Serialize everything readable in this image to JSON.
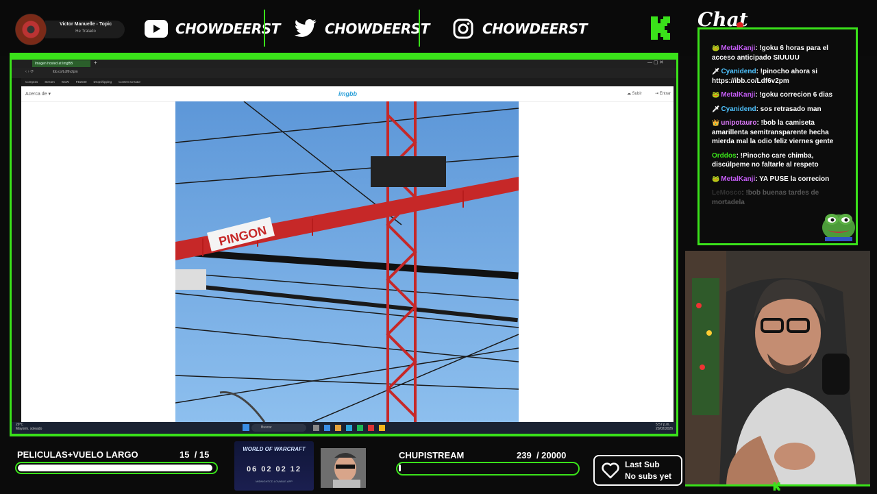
{
  "music": {
    "title": "Victor Manuelle - Topic",
    "subtitle": "He Tratado"
  },
  "socials": [
    {
      "icon": "youtube-icon",
      "name": "CHOWDEERST"
    },
    {
      "icon": "twitter-icon",
      "name": "CHOWDEERST"
    },
    {
      "icon": "instagram-icon",
      "name": "CHOWDEERST"
    }
  ],
  "chat": {
    "title": "Chat",
    "messages": [
      {
        "user": "MetalKanji",
        "user_color": "#c45cf5",
        "text": "!goku 6 horas para el acceso anticipado SIUUUU"
      },
      {
        "user": "Cyanidend",
        "user_color": "#4fc3ff",
        "text": "!pinocho ahora si https://ibb.co/Ldf6v2pm"
      },
      {
        "user": "MetalKanji",
        "user_color": "#c45cf5",
        "text": "!goku correcion 6 dias"
      },
      {
        "user": "Cyanidend",
        "user_color": "#4fc3ff",
        "text": "sos retrasado man"
      },
      {
        "user": "unipotauro",
        "user_color": "#e07bff",
        "text": "!bob la camiseta amarillenta semitransparente hecha mierda mal la odio feliz viernes gente"
      },
      {
        "user": "Orddos",
        "user_color": "#3ae21a",
        "text": "!Pinocho care chimba, discúlpeme no faltarle al respeto"
      },
      {
        "user": "MetalKanji",
        "user_color": "#c45cf5",
        "text": "YA PUSE la correcion"
      },
      {
        "user": "LeMosco",
        "user_color": "#5a5a5a",
        "text": "!bob buenas tardes de mortadela"
      }
    ]
  },
  "browser": {
    "tab_title": "Imagen hosted at ImgBB",
    "url": "ibb.co/Ldf6v2pm",
    "bookmarks": [
      "Compras",
      "Stream",
      "WoW",
      "FB2030",
      "Dropshipping",
      "Content Creator"
    ],
    "nav_left": "Acerca de",
    "site_logo": "imgbb",
    "upload": "Subir",
    "login": "Entrar",
    "photo_sign": "PINGON"
  },
  "taskbar": {
    "temp": "29°C",
    "weather": "Mayorm. soleado",
    "search": "Buscar",
    "time": "5:57 p.m.",
    "date": "20/02/2026"
  },
  "goal1": {
    "label": "PELICULAS+VUELO LARGO",
    "count": "15",
    "total": "/ 15",
    "progress": 1.0
  },
  "wow": {
    "logo": "WORLD OF WARCRAFT",
    "countdown": "06 02 02 12",
    "url": "MIDNIGHTCD.LOVABLE.APP"
  },
  "goal2": {
    "label": "CHUPISTREAM",
    "count": "239",
    "total": "/ 20000",
    "progress": 0.012
  },
  "subs": {
    "line1": "Last Sub",
    "line2": "No subs yet"
  },
  "colors": {
    "accent": "#3ae21a",
    "background": "#0b0b0b"
  }
}
